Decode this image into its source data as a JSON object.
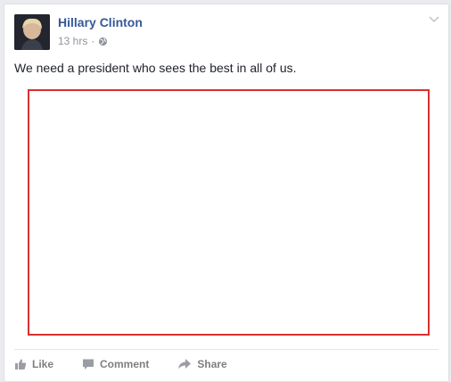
{
  "post": {
    "author": "Hillary Clinton",
    "timestamp": "13 hrs",
    "separator": "·",
    "privacy_icon": "globe-icon",
    "menu_icon": "chevron-down-icon",
    "text": "We need a president who sees the best in all of us."
  },
  "actions": {
    "like_label": "Like",
    "comment_label": "Comment",
    "share_label": "Share"
  },
  "colors": {
    "author_link": "#365899",
    "meta_text": "#90949c",
    "body_text": "#1d2129",
    "action_text": "#7f7f7f",
    "media_outline": "#d9302f"
  }
}
